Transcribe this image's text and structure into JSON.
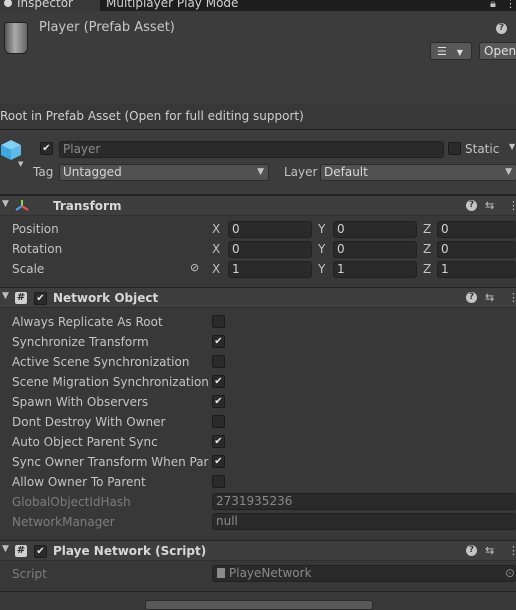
{
  "tabs": [
    {
      "label": "Inspector",
      "active": true
    },
    {
      "label": "Multiplayer Play Mode",
      "active": false
    }
  ],
  "header": {
    "title": "Player (Prefab Asset)",
    "open_label": "Open",
    "help_icon": "?"
  },
  "info": "Root in Prefab Asset (Open for full editing support)",
  "gameobject": {
    "active": true,
    "name_placeholder": "Player",
    "static_label": "Static",
    "static_checked": false,
    "tag_label": "Tag",
    "tag_value": "Untagged",
    "layer_label": "Layer",
    "layer_value": "Default"
  },
  "transform": {
    "title": "Transform",
    "rows": [
      {
        "label": "Position",
        "x": "0",
        "y": "0",
        "z": "0"
      },
      {
        "label": "Rotation",
        "x": "0",
        "y": "0",
        "z": "0"
      },
      {
        "label": "Scale",
        "x": "1",
        "y": "1",
        "z": "1"
      }
    ],
    "axis": {
      "x": "X",
      "y": "Y",
      "z": "Z"
    }
  },
  "network_object": {
    "title": "Network Object",
    "enabled": true,
    "props": [
      {
        "label": "Always Replicate As Root",
        "checked": false
      },
      {
        "label": "Synchronize Transform",
        "checked": true
      },
      {
        "label": "Active Scene Synchronization",
        "checked": false
      },
      {
        "label": "Scene Migration Synchronization",
        "checked": true
      },
      {
        "label": "Spawn With Observers",
        "checked": true
      },
      {
        "label": "Dont Destroy With Owner",
        "checked": false
      },
      {
        "label": "Auto Object Parent Sync",
        "checked": true
      },
      {
        "label": "Sync Owner Transform When Parer",
        "checked": true
      },
      {
        "label": "Allow Owner To Parent",
        "checked": false
      }
    ],
    "hash_label": "GlobalObjectIdHash",
    "hash_value": "2731935236",
    "manager_label": "NetworkManager",
    "manager_value": "null"
  },
  "script_component": {
    "title": "Playe Network (Script)",
    "enabled": true,
    "script_label": "Script",
    "script_value": "PlayeNetwork"
  },
  "colors": {
    "background": "#383838",
    "header": "#3e3e3e",
    "field": "#2a2a2a",
    "text": "#c4c4c4"
  }
}
